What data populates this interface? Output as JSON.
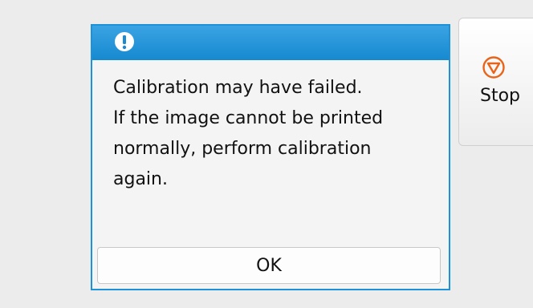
{
  "dialog": {
    "icon": "exclamation-circle-icon",
    "message_lines": [
      "Calibration may have failed.",
      "If the image cannot be printed",
      "normally, perform calibration",
      "again."
    ],
    "ok_label": "OK"
  },
  "side": {
    "stop_icon": "stop-octagon-icon",
    "stop_label": "Stop"
  },
  "colors": {
    "header_blue": "#1e92d8",
    "stop_orange": "#e8641a",
    "background": "#ececec"
  }
}
